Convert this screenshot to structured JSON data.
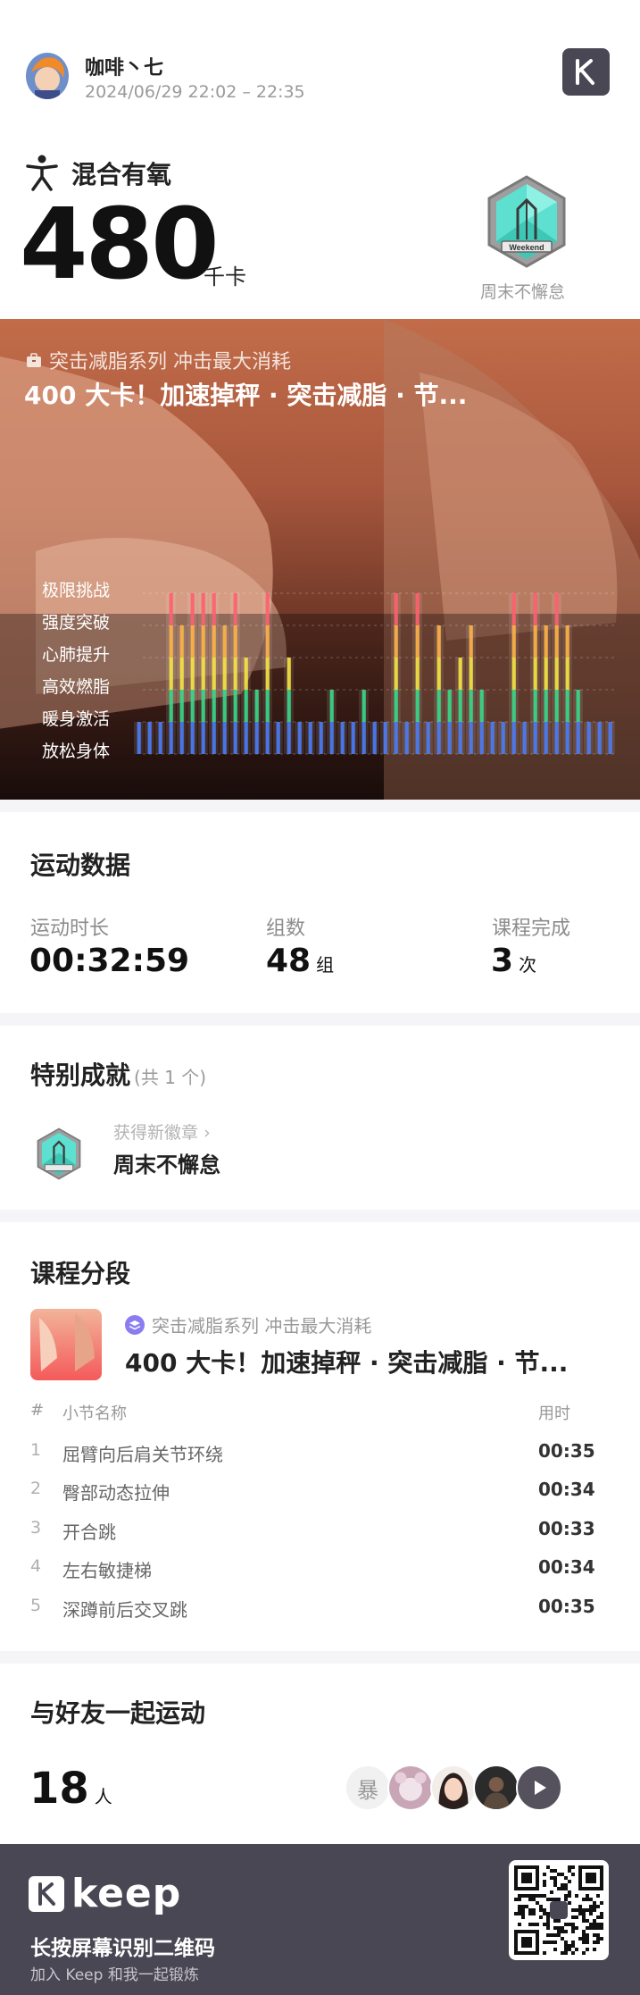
{
  "header": {
    "username": "咖啡丶七",
    "datetime": "2024/06/29 22:02 – 22:35",
    "sport_type": "混合有氧",
    "calories": "480",
    "calories_unit": "千卡",
    "badge_label": "周末不懈怠",
    "badge_text": "Weekend"
  },
  "hero": {
    "series": "突击减脂系列 冲击最大消耗",
    "title": "400 大卡！加速掉秤 · 突击减脂 · 节...",
    "zones": [
      "极限挑战",
      "强度突破",
      "心肺提升",
      "高效燃脂",
      "暖身激活",
      "放松身体"
    ],
    "zone_colors": [
      "#ff5f6d",
      "#ffb347",
      "#f5e542",
      "#39d98a",
      "#4a7cf7",
      "#8f8f8f"
    ]
  },
  "stats": {
    "title": "运动数据",
    "duration_label": "运动时长",
    "duration_value": "00:32:59",
    "sets_label": "组数",
    "sets_value": "48",
    "sets_unit": "组",
    "courses_label": "课程完成",
    "courses_value": "3",
    "courses_unit": "次"
  },
  "achievements": {
    "title": "特别成就",
    "count": "(共 1 个)",
    "new_badge_label": "获得新徽章",
    "badge_name": "周末不懈怠"
  },
  "course": {
    "title": "课程分段",
    "series": "突击减脂系列 冲击最大消耗",
    "name": "400 大卡！加速掉秤 · 突击减脂 · 节...",
    "col_index": "#",
    "col_name": "小节名称",
    "col_time": "用时",
    "rows": [
      {
        "idx": "1",
        "name": "屈臂向后肩关节环绕",
        "time": "00:35"
      },
      {
        "idx": "2",
        "name": "臀部动态拉伸",
        "time": "00:34"
      },
      {
        "idx": "3",
        "name": "开合跳",
        "time": "00:33"
      },
      {
        "idx": "4",
        "name": "左右敏捷梯",
        "time": "00:34"
      },
      {
        "idx": "5",
        "name": "深蹲前后交叉跳",
        "time": "00:35"
      }
    ]
  },
  "friends": {
    "title": "与好友一起运动",
    "count": "18",
    "unit": "人",
    "first_avatar_text": "暴"
  },
  "footer": {
    "brand": "keep",
    "line1": "长按屏幕识别二维码",
    "line2": "加入 Keep 和我一起锻炼"
  }
}
